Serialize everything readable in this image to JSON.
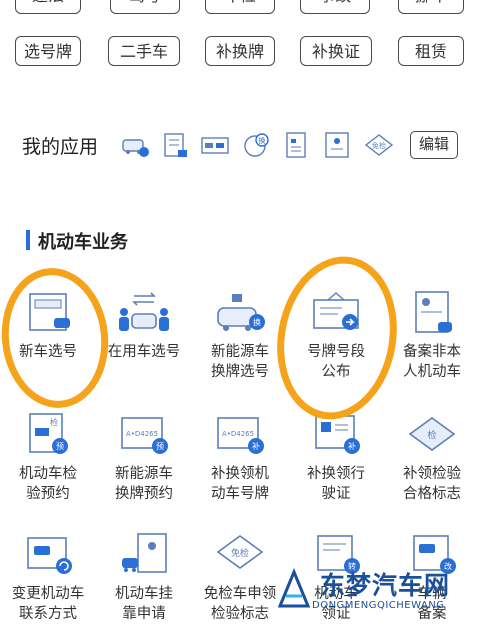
{
  "top_tags_row1": [
    "违法",
    "驾考",
    "车检",
    "事故",
    "挪车"
  ],
  "top_tags_row2": [
    "选号牌",
    "二手车",
    "补换牌",
    "补换证",
    "租赁"
  ],
  "my_apps": {
    "label": "我的应用",
    "edit_label": "编辑",
    "icons": [
      "car-id-icon",
      "document-icon",
      "plate-swap-icon",
      "sticker-icon",
      "form-icon",
      "certificate-icon",
      "exempt-badge-icon"
    ],
    "exempt_text": "免检",
    "swap_text": "换"
  },
  "section": {
    "title": "机动车业务",
    "accent": "#2a6fd6",
    "items": [
      {
        "label": "新车选号",
        "icon": "new-plate-icon"
      },
      {
        "label": "在用车选号",
        "icon": "car-transfer-icon"
      },
      {
        "label": "新能源车\n换牌选号",
        "icon": "ev-plate-icon",
        "badge": "换"
      },
      {
        "label": "号牌号段\n公布",
        "icon": "plate-announce-icon"
      },
      {
        "label": "备案非本\n人机动车",
        "icon": "record-icon"
      },
      {
        "label": "机动车检\n验预约",
        "icon": "inspection-booking-icon",
        "badge": "预",
        "tag": "检"
      },
      {
        "label": "新能源车\n换牌预约",
        "icon": "ev-booking-icon",
        "badge": "预",
        "plate": "A•D4265"
      },
      {
        "label": "补换领机\n动车号牌",
        "icon": "replace-plate-icon",
        "badge": "补",
        "plate": "A•D4265"
      },
      {
        "label": "补换领行\n驶证",
        "icon": "replace-license-icon",
        "badge": "补"
      },
      {
        "label": "补领检验\n合格标志",
        "icon": "inspection-mark-icon",
        "tag": "检"
      },
      {
        "label": "变更机动车\n联系方式",
        "icon": "contact-change-icon"
      },
      {
        "label": "机动车挂\n靠申请",
        "icon": "affiliation-icon"
      },
      {
        "label": "免检车申领\n检验标志",
        "icon": "exempt-mark-icon",
        "tag": "免检"
      },
      {
        "label": "机动车\n领证",
        "icon": "collect-icon",
        "badge": "转"
      },
      {
        "label": "车辆\n备案",
        "icon": "vehicle-record-icon",
        "badge": "改"
      }
    ]
  },
  "highlight_color": "#f5a31a",
  "watermark": {
    "text": "东梦汽车网",
    "sub": "DONGMENGQICHEWANG"
  }
}
